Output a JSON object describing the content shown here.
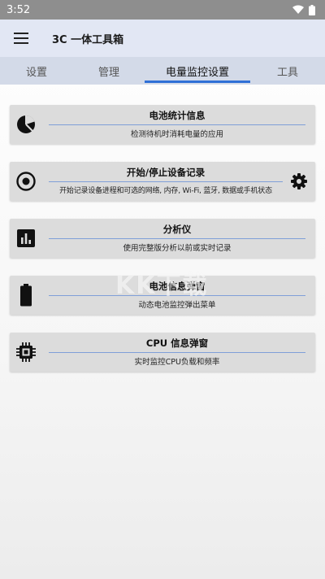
{
  "status_bar": {
    "time": "3:52",
    "icons": [
      "wifi-icon",
      "battery-icon"
    ]
  },
  "app_bar": {
    "title": "3C 一体工具箱",
    "menu_icon": "menu-icon"
  },
  "tabs": [
    {
      "label": "设置",
      "active": false
    },
    {
      "label": "管理",
      "active": false
    },
    {
      "label": "电量监控设置",
      "active": true
    },
    {
      "label": "工具",
      "active": false
    }
  ],
  "cards": [
    {
      "title": "电池统计信息",
      "subtitle": "检测待机时消耗电量的应用",
      "icon": "pie-chart-icon"
    },
    {
      "title": "开始/停止设备记录",
      "subtitle": "开始记录设备进程和可选的网络, 内存, Wi-Fi, 蓝牙, 数据或手机状态",
      "icon": "record-icon",
      "trailing_icon": "gear-icon"
    },
    {
      "title": "分析仪",
      "subtitle": "使用完整版分析以前或实时记录",
      "icon": "bar-chart-icon"
    },
    {
      "title": "电池信息弹窗",
      "subtitle": "动态电池监控弹出菜单",
      "icon": "battery-icon"
    },
    {
      "title": "CPU 信息弹窗",
      "subtitle": "实时监控CPU负载和频率",
      "icon": "cpu-chip-icon"
    }
  ],
  "colors": {
    "accent": "#2f6fd6",
    "app_bar": "#e2e7f4",
    "tab_bar": "#d3dae8",
    "card": "#dcdcdc",
    "status_bar": "#8e8e8e"
  },
  "watermark": "KK下载"
}
